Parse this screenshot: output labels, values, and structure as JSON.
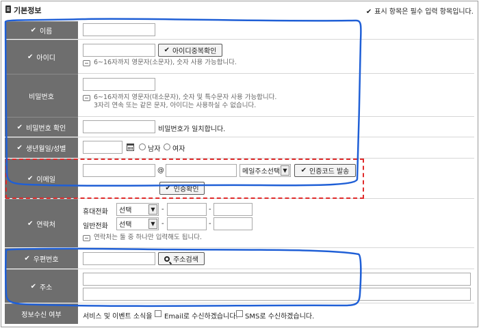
{
  "header": {
    "title": "기본정보",
    "required_note": "표시 항목은 필수 입력 항목입니다."
  },
  "rows": {
    "name": {
      "label": "이름"
    },
    "userid": {
      "label": "아이디",
      "check_button": "아이디중복확인",
      "hint": "6~16자까지 영문자(소문자), 숫자 사용 가능합니다."
    },
    "password": {
      "label": "비밀번호",
      "hint1": "6~16자까지 영문자(대소문자), 숫자 및 특수문자 사용 가능합니다.",
      "hint2": "3자리 연속 또는 같은 문자, 아이디는 사용하실 수 없습니다."
    },
    "password_confirm": {
      "label": "비밀번호 확인",
      "message": "비밀번호가 일치합니다."
    },
    "birth": {
      "label": "생년월일/성별",
      "male": "남자",
      "female": "여자"
    },
    "email": {
      "label": "이메일",
      "at": "@",
      "domain_select": "메일주소선택",
      "send_code_button": "인증코드 발송",
      "verify_button": "인증확인"
    },
    "contact": {
      "label": "연락처",
      "mobile_label": "휴대전화",
      "home_label": "일반전화",
      "select_text": "선택",
      "dash": "-",
      "hint": "연락처는 둘 중 하나만 입력해도 됩니다."
    },
    "zipcode": {
      "label": "우편번호",
      "search_button": "주소검색"
    },
    "address": {
      "label": "주소"
    },
    "consent": {
      "label": "정보수신 여부",
      "prefix": "서비스 및 이벤트 소식을",
      "email_option": "Email로 수신하겠습니다.",
      "sms_option": "SMS로 수신하겠습니다."
    }
  },
  "colors": {
    "label_bg": "#6e6e6e",
    "annotation_blue": "#1f5fd6",
    "annotation_red": "#e02a2a"
  }
}
